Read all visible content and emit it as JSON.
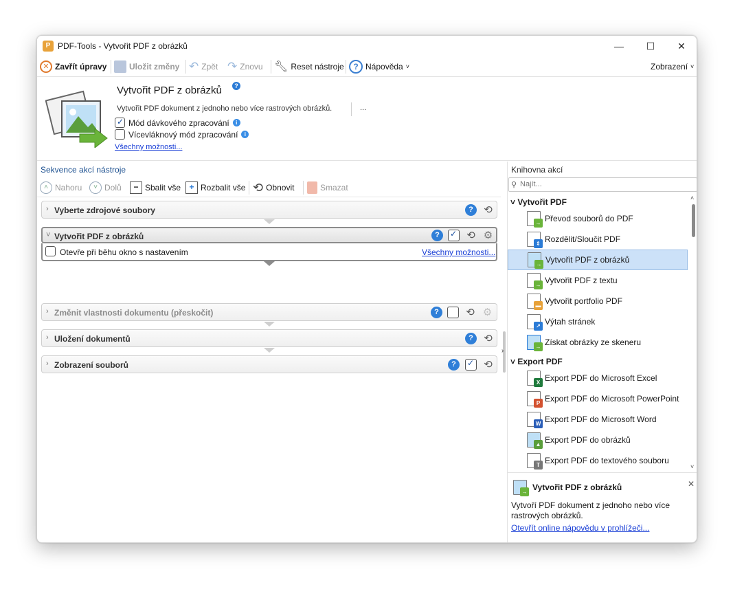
{
  "window": {
    "title": "PDF-Tools - Vytvořit PDF z obrázků"
  },
  "toolbar": {
    "close_edit": "Zavřít úpravy",
    "save": "Uložit změny",
    "undo": "Zpět",
    "redo": "Znovu",
    "reset": "Reset nástroje",
    "help": "Nápověda",
    "view": "Zobrazení"
  },
  "header": {
    "title": "Vytvořit PDF z obrázků",
    "description": "Vytvořit PDF dokument z jednoho nebo více rastrových obrázků.",
    "more": "...",
    "batch_mode": "Mód dávkového zpracování",
    "batch_mode_checked": true,
    "multithread_mode": "Vícevláknový mód zpracování",
    "multithread_mode_checked": false,
    "all_options": "Všechny možnosti..."
  },
  "sequence": {
    "title": "Sekvence akcí nástroje",
    "toolbar": {
      "up": "Nahoru",
      "down": "Dolů",
      "collapse_all": "Sbalit vše",
      "expand_all": "Rozbalit vše",
      "refresh": "Obnovit",
      "delete": "Smazat"
    },
    "actions": [
      {
        "label": "Vyberte zdrojové soubory"
      },
      {
        "label": "Vytvořit PDF z obrázků",
        "checked": true,
        "option": "Otevře při běhu okno s nastavením",
        "option_link": "Všechny možnosti..."
      },
      {
        "label": "Změnit vlastnosti dokumentu (přeskočit)",
        "checked": false
      },
      {
        "label": "Uložení dokumentů"
      },
      {
        "label": "Zobrazení souborů",
        "checked": true
      }
    ]
  },
  "library": {
    "title": "Knihovna akcí",
    "search_placeholder": "Najít...",
    "groups": [
      {
        "name": "Vytvořit PDF",
        "items": [
          {
            "label": "Převod souborů do PDF",
            "icon": "convert-files-icon"
          },
          {
            "label": "Rozdělit/Sloučit PDF",
            "icon": "split-merge-icon"
          },
          {
            "label": "Vytvořit PDF z obrázků",
            "icon": "image-to-pdf-icon",
            "selected": true
          },
          {
            "label": "Vytvořit PDF z textu",
            "icon": "text-to-pdf-icon"
          },
          {
            "label": "Vytvořit portfolio PDF",
            "icon": "portfolio-icon"
          },
          {
            "label": "Výtah stránek",
            "icon": "extract-pages-icon"
          },
          {
            "label": "Získat obrázky ze skeneru",
            "icon": "scanner-icon"
          }
        ]
      },
      {
        "name": "Export PDF",
        "items": [
          {
            "label": "Export PDF do Microsoft Excel",
            "icon": "excel-icon"
          },
          {
            "label": "Export PDF do Microsoft PowerPoint",
            "icon": "powerpoint-icon"
          },
          {
            "label": "Export PDF do Microsoft Word",
            "icon": "word-icon"
          },
          {
            "label": "Export PDF do obrázků",
            "icon": "export-image-icon"
          },
          {
            "label": "Export PDF do textového souboru",
            "icon": "export-text-icon"
          }
        ]
      }
    ]
  },
  "info": {
    "title": "Vytvořit PDF z obrázků",
    "description": "Vytvoří PDF dokument z jednoho nebo více rastrových obrázků.",
    "link": "Otevřít online nápovědu v prohlížeči..."
  },
  "colors": {
    "accent": "#2b7bd6",
    "selection": "#cce1f8",
    "link": "#1a3fd6",
    "section_title": "#1b4f8f"
  }
}
